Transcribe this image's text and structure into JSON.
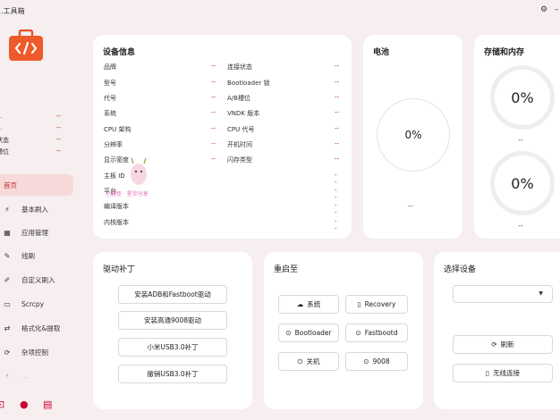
{
  "app": {
    "title": "...工具箱"
  },
  "sidebar": {
    "info": [
      {
        "label": "...",
        "value": "--"
      },
      {
        "label": "...",
        "value": "--"
      },
      {
        "label": "状态",
        "value": "--"
      },
      {
        "label": "槽位",
        "value": "--"
      }
    ],
    "nav": [
      {
        "label": "首页",
        "icon": "home-icon"
      },
      {
        "label": "基本刷入",
        "icon": "bolt-icon"
      },
      {
        "label": "应用管理",
        "icon": "grid-icon"
      },
      {
        "label": "线刷",
        "icon": "pen-icon"
      },
      {
        "label": "自定义刷入",
        "icon": "brush-icon"
      },
      {
        "label": "Scrcpy",
        "icon": "screen-icon"
      },
      {
        "label": "格式化&提取",
        "icon": "format-icon"
      },
      {
        "label": "杂项控制",
        "icon": "misc-icon"
      },
      {
        "label": "...",
        "icon": "more-icon"
      }
    ]
  },
  "device_info": {
    "title": "设备信息",
    "left": [
      {
        "label": "品牌",
        "value": "--"
      },
      {
        "label": "型号",
        "value": "--"
      },
      {
        "label": "代号",
        "value": "--"
      },
      {
        "label": "系统",
        "value": "--"
      },
      {
        "label": "CPU 架构",
        "value": "--"
      },
      {
        "label": "分辨率",
        "value": "--"
      },
      {
        "label": "显示密度",
        "value": "--"
      },
      {
        "label": "主板 ID",
        "value": "--"
      },
      {
        "label": "平台",
        "value": "--"
      },
      {
        "label": "编译版本",
        "value": "--"
      },
      {
        "label": "内核版本",
        "value": "--"
      }
    ],
    "right": [
      {
        "label": "连接状态",
        "value": "--"
      },
      {
        "label": "Bootloader 锁",
        "value": "--"
      },
      {
        "label": "A/B槽位",
        "value": "--"
      },
      {
        "label": "VNDK 版本",
        "value": "--"
      },
      {
        "label": "CPU 代号",
        "value": "--"
      },
      {
        "label": "开机时间",
        "value": "--"
      },
      {
        "label": "闪存类型",
        "value": "--"
      }
    ]
  },
  "battery": {
    "title": "电池",
    "percent": "0%",
    "sub": "--"
  },
  "storage": {
    "title": "存储和内存",
    "storage_percent": "0%",
    "storage_sub": "--",
    "memory_percent": "0%",
    "memory_sub": "--"
  },
  "driver": {
    "title": "驱动补丁",
    "buttons": [
      "安装ADB和Fastboot驱动",
      "安装高通9008驱动",
      "小米USB3.0补丁",
      "撤销USB3.0补丁"
    ]
  },
  "reboot": {
    "title": "重启至",
    "buttons": [
      {
        "label": "系统",
        "icon": "cloud-icon"
      },
      {
        "label": "Recovery",
        "icon": "recovery-icon"
      },
      {
        "label": "Bootloader",
        "icon": "bootloader-icon"
      },
      {
        "label": "Fastbootd",
        "icon": "fastbootd-icon"
      },
      {
        "label": "关机",
        "icon": "power-icon"
      },
      {
        "label": "9008",
        "icon": "edl-icon"
      }
    ]
  },
  "select_device": {
    "title": "选择设备",
    "selected": "",
    "refresh": "刷新",
    "wireless": "无线连接"
  },
  "watermark": "小脚怪 · 星宇分享"
}
